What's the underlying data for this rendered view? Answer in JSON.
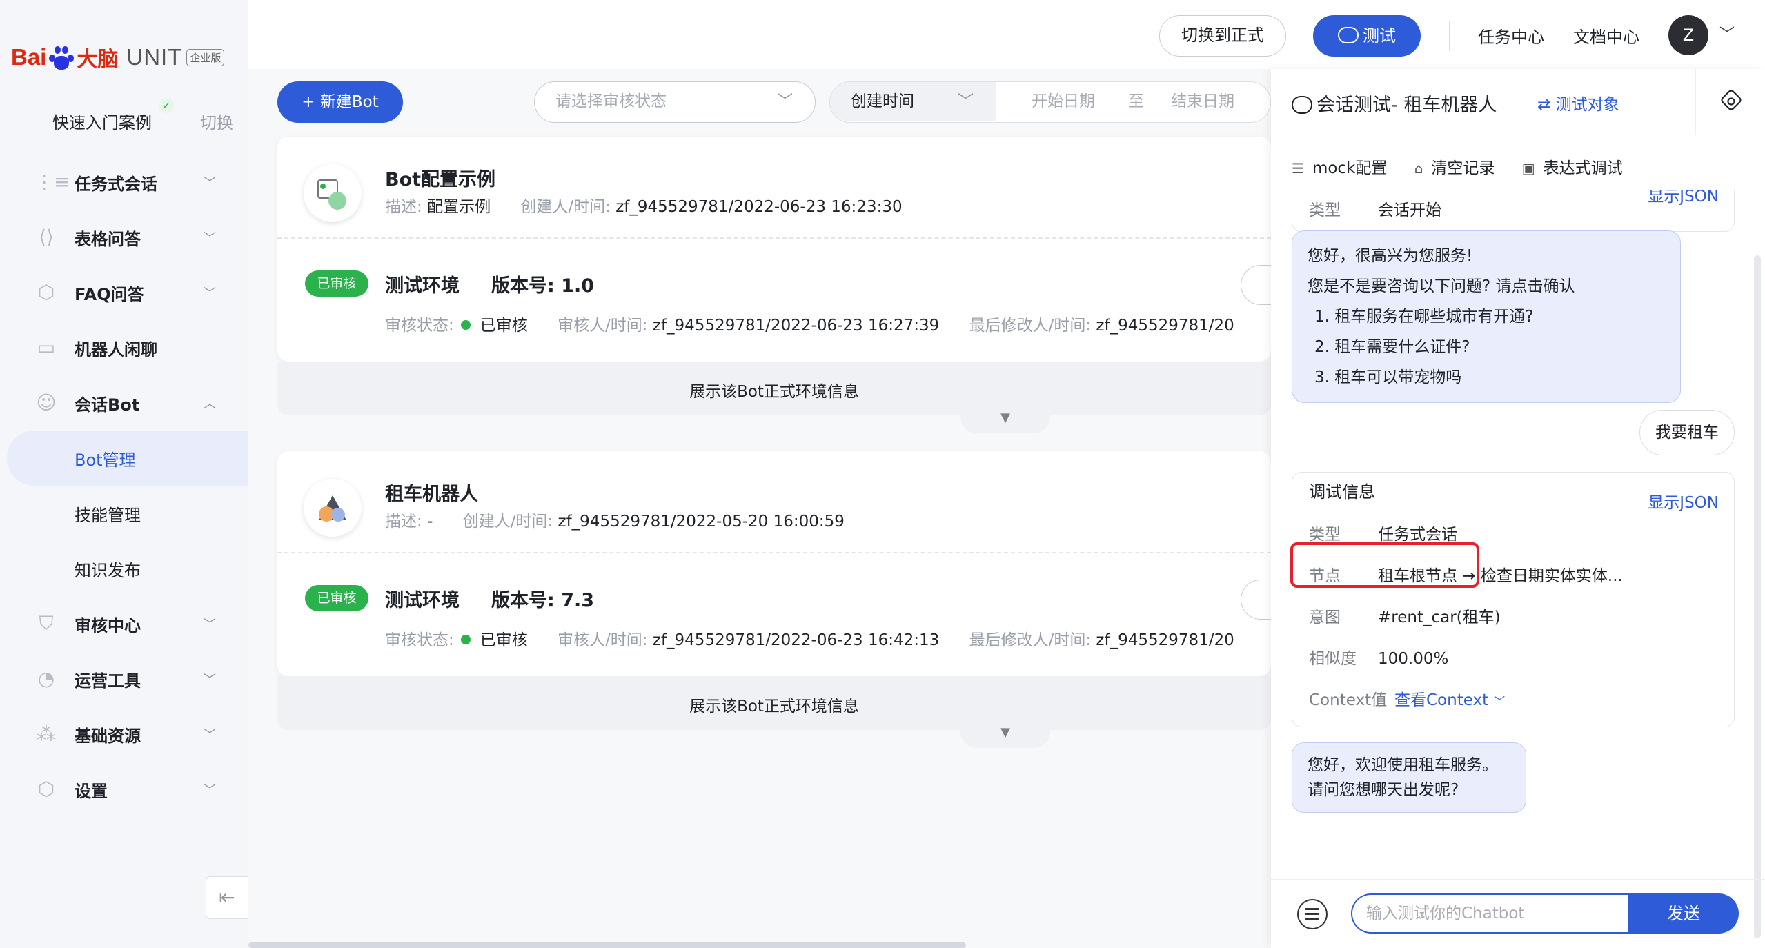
{
  "brand": {
    "bai": "Bai",
    "du": "du",
    "danao": "大脑",
    "unit": "UNIT",
    "edition": "企业版"
  },
  "sidebar": {
    "quick_case": "快速入门案例",
    "switch_label": "切换",
    "items": [
      {
        "label": "任务式会话",
        "icon": "task-dialog-icon",
        "expanded": false
      },
      {
        "label": "表格问答",
        "icon": "table-qa-icon",
        "expanded": false
      },
      {
        "label": "FAQ问答",
        "icon": "faq-icon",
        "expanded": false
      },
      {
        "label": "机器人闲聊",
        "icon": "chitchat-icon"
      },
      {
        "label": "会话Bot",
        "icon": "bot-icon",
        "expanded": true
      },
      {
        "label": "Bot管理",
        "sub": true,
        "active": true
      },
      {
        "label": "技能管理",
        "sub": true
      },
      {
        "label": "知识发布",
        "sub": true
      },
      {
        "label": "审核中心",
        "icon": "shield-icon",
        "expanded": false
      },
      {
        "label": "运营工具",
        "icon": "tools-icon",
        "expanded": false
      },
      {
        "label": "基础资源",
        "icon": "resources-icon",
        "expanded": false
      },
      {
        "label": "设置",
        "icon": "settings-icon",
        "expanded": false
      }
    ]
  },
  "topbar": {
    "switch_formal": "切换到正式",
    "test": "测试",
    "task_center": "任务中心",
    "doc_center": "文档中心",
    "avatar_letter": "Z"
  },
  "toolbar": {
    "new_bot": "+ 新建Bot",
    "status_placeholder": "请选择审核状态",
    "date_type": "创建时间",
    "start_date": "开始日期",
    "to": "至",
    "end_date": "结束日期"
  },
  "bots": [
    {
      "name": "Bot配置示例",
      "desc_label": "描述:",
      "desc": "配置示例",
      "creator_label": "创建人/时间:",
      "creator": "zf_945529781/2022-06-23 16:23:30",
      "badge": "已审核",
      "env": "测试环境",
      "version_label": "版本号:",
      "version": "1.0",
      "status_label": "审核状态:",
      "status": "已审核",
      "reviewer_label": "审核人/时间:",
      "reviewer": "zf_945529781/2022-06-23 16:27:39",
      "modifier_label": "最后修改人/时间:",
      "modifier": "zf_945529781/20",
      "expand": "展示该Bot正式环境信息"
    },
    {
      "name": "租车机器人",
      "desc_label": "描述:",
      "desc": "-",
      "creator_label": "创建人/时间:",
      "creator": "zf_945529781/2022-05-20 16:00:59",
      "badge": "已审核",
      "env": "测试环境",
      "version_label": "版本号:",
      "version": "7.3",
      "status_label": "审核状态:",
      "status": "已审核",
      "reviewer_label": "审核人/时间:",
      "reviewer": "zf_945529781/2022-06-23 16:42:13",
      "modifier_label": "最后修改人/时间:",
      "modifier": "zf_945529781/20",
      "expand": "展示该Bot正式环境信息"
    }
  ],
  "chat": {
    "title": "会话测试- 租车机器人",
    "target": "⇄ 测试对象",
    "tools": [
      "mock配置",
      "清空记录",
      "表达式调试"
    ],
    "first_info": {
      "type_label": "类型",
      "type": "会话开始",
      "show_json": "显示JSON"
    },
    "welcome_lines": [
      "您好，很高兴为您服务!",
      "您是不是要咨询以下问题? 请点击确认",
      "1. 租车服务在哪些城市有开通?",
      "2. 租车需要什么证件?",
      "3. 租车可以带宠物吗"
    ],
    "user_msg": "我要租车",
    "debug": {
      "title": "调试信息",
      "show_json": "显示JSON",
      "type_label": "类型",
      "type": "任务式会话",
      "node_label": "节点",
      "node": "租车根节点 → 检查日期实体实体...",
      "intent_label": "意图",
      "intent": "#rent_car(租车)",
      "similarity_label": "相似度",
      "similarity": "100.00%",
      "context_label": "Context值",
      "context_link": "查看Context"
    },
    "reply_lines": [
      "您好，欢迎使用租车服务。",
      "请问您想哪天出发呢?"
    ],
    "input_placeholder": "输入测试你的Chatbot",
    "send": "发送"
  },
  "colors": {
    "primary": "#2e5bd8",
    "success": "#2bb24c",
    "highlight": "#e5212e",
    "brand_red": "#de2910",
    "brand_blue": "#2932e1"
  }
}
